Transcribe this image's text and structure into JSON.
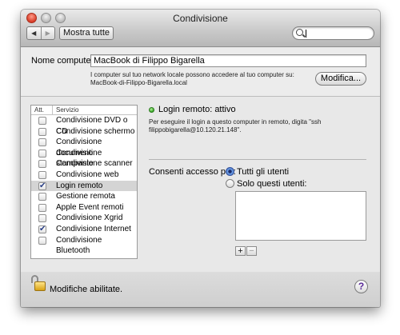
{
  "window": {
    "title": "Condivisione"
  },
  "toolbar": {
    "back_icon": "back-arrow-icon",
    "forward_icon": "forward-arrow-icon",
    "show_all_label": "Mostra tutte",
    "search_icon": "magnifier-icon",
    "search_value": ""
  },
  "computer": {
    "label": "Nome computer:",
    "name": "MacBook di Filippo Bigarella",
    "info_line1": "I computer sul tuo network locale possono accedere al tuo computer su:",
    "info_line2": "MacBook-di-Filippo-Bigarella.local",
    "edit_label": "Modifica..."
  },
  "services": {
    "col_on": "Att.",
    "col_service": "Servizio",
    "items": [
      {
        "label": "Condivisione DVD o CD",
        "checked": false,
        "selected": false
      },
      {
        "label": "Condivisione schermo",
        "checked": false,
        "selected": false
      },
      {
        "label": "Condivisione documenti",
        "checked": false,
        "selected": false
      },
      {
        "label": "Condivisione stampante",
        "checked": false,
        "selected": false
      },
      {
        "label": "Condivisione scanner",
        "checked": false,
        "selected": false
      },
      {
        "label": "Condivisione web",
        "checked": false,
        "selected": false
      },
      {
        "label": "Login remoto",
        "checked": true,
        "selected": true
      },
      {
        "label": "Gestione remota",
        "checked": false,
        "selected": false
      },
      {
        "label": "Apple Event remoti",
        "checked": false,
        "selected": false
      },
      {
        "label": "Condivisione Xgrid",
        "checked": false,
        "selected": false
      },
      {
        "label": "Condivisione Internet",
        "checked": true,
        "selected": false
      },
      {
        "label": "Condivisione Bluetooth",
        "checked": false,
        "selected": false
      }
    ]
  },
  "detail": {
    "status_text": "Login remoto: attivo",
    "status_color": "#2fa31c",
    "description_line1": "Per eseguire il login a questo computer in remoto, digita \"ssh",
    "description_line2": "filippobigarella@10.120.21.148\".",
    "access_label": "Consenti accesso per:",
    "option_all": "Tutti gli utenti",
    "option_only": "Solo questi utenti:",
    "selected_option": "Tutti gli utenti",
    "add_label": "+",
    "remove_label": "−"
  },
  "footer": {
    "lock_icon": "unlocked-padlock-icon",
    "lock_text": "Modifiche abilitate.",
    "help_label": "?"
  }
}
